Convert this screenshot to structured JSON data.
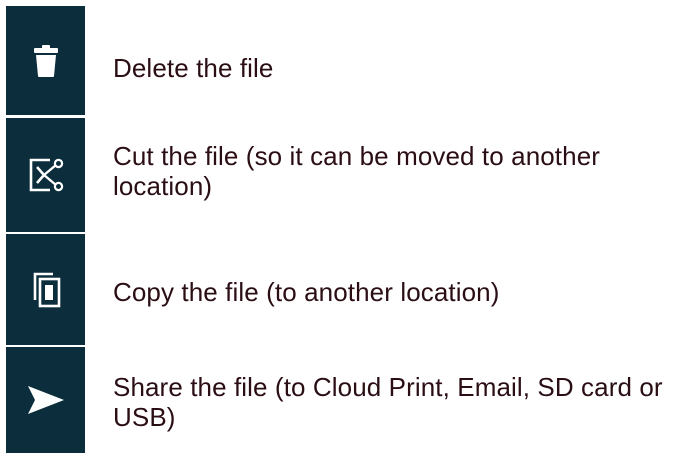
{
  "colors": {
    "tile_background": "#0b2d3c",
    "icon": "#ffffff",
    "text": "#2a0e14"
  },
  "actions": [
    {
      "icon": "trash-icon",
      "label": "Delete the file"
    },
    {
      "icon": "cut-icon",
      "label": "Cut the file (so it can be moved to another location)"
    },
    {
      "icon": "copy-icon",
      "label": "Copy the file (to another location)"
    },
    {
      "icon": "share-icon",
      "label": "Share the file (to Cloud Print, Email, SD card or USB)"
    }
  ]
}
